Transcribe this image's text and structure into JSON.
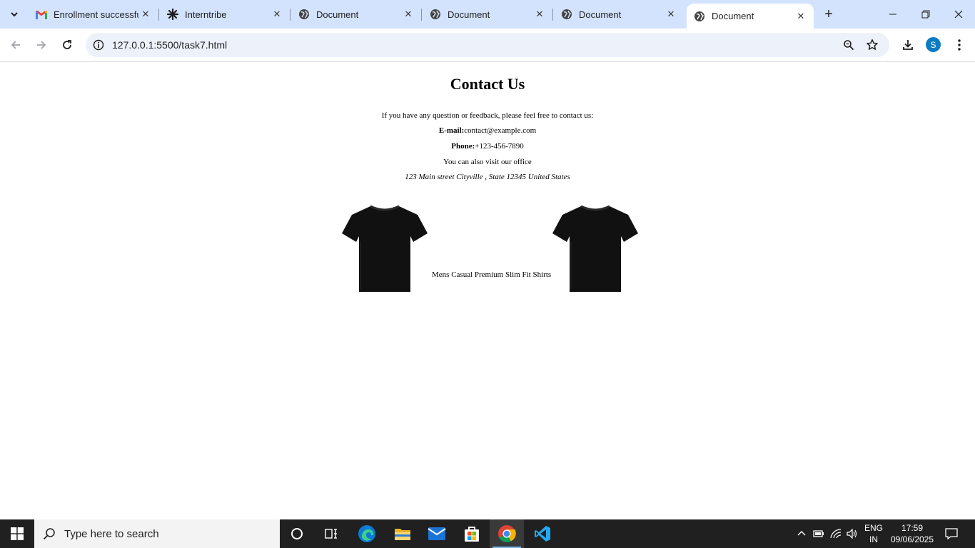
{
  "browser": {
    "tabs": [
      {
        "title": "Enrollment successful",
        "favicon": "gmail-icon",
        "active": false
      },
      {
        "title": "Interntribe",
        "favicon": "interntribe-icon",
        "active": false
      },
      {
        "title": "Document",
        "favicon": "globe-icon",
        "active": false
      },
      {
        "title": "Document",
        "favicon": "globe-icon",
        "active": false
      },
      {
        "title": "Document",
        "favicon": "globe-icon",
        "active": false
      },
      {
        "title": "Document",
        "favicon": "globe-icon",
        "active": true
      }
    ],
    "url": "127.0.0.1:5500/task7.html",
    "profile_initial": "S",
    "accent_color": "#d3e3fd"
  },
  "page": {
    "heading": "Contact Us",
    "intro": "If you have any question or feedback, please feel free to contact us:",
    "email_label": "E-mail:",
    "email_value": "contact@example.com",
    "phone_label": "Phone:",
    "phone_value": "+123-456-7890",
    "visit_text": "You can also visit our office",
    "address": "123 Main street Cityville , State 12345 United States",
    "product_caption": "Mens Casual Premium Slim Fit Shirts"
  },
  "taskbar": {
    "search_placeholder": "Type here to search",
    "apps": [
      "task-view-icon",
      "edge-icon",
      "file-explorer-icon",
      "mail-icon",
      "store-icon",
      "chrome-icon",
      "vscode-icon"
    ],
    "language": "ENG",
    "region": "IN",
    "time": "17:59",
    "date": "09/06/2025"
  }
}
